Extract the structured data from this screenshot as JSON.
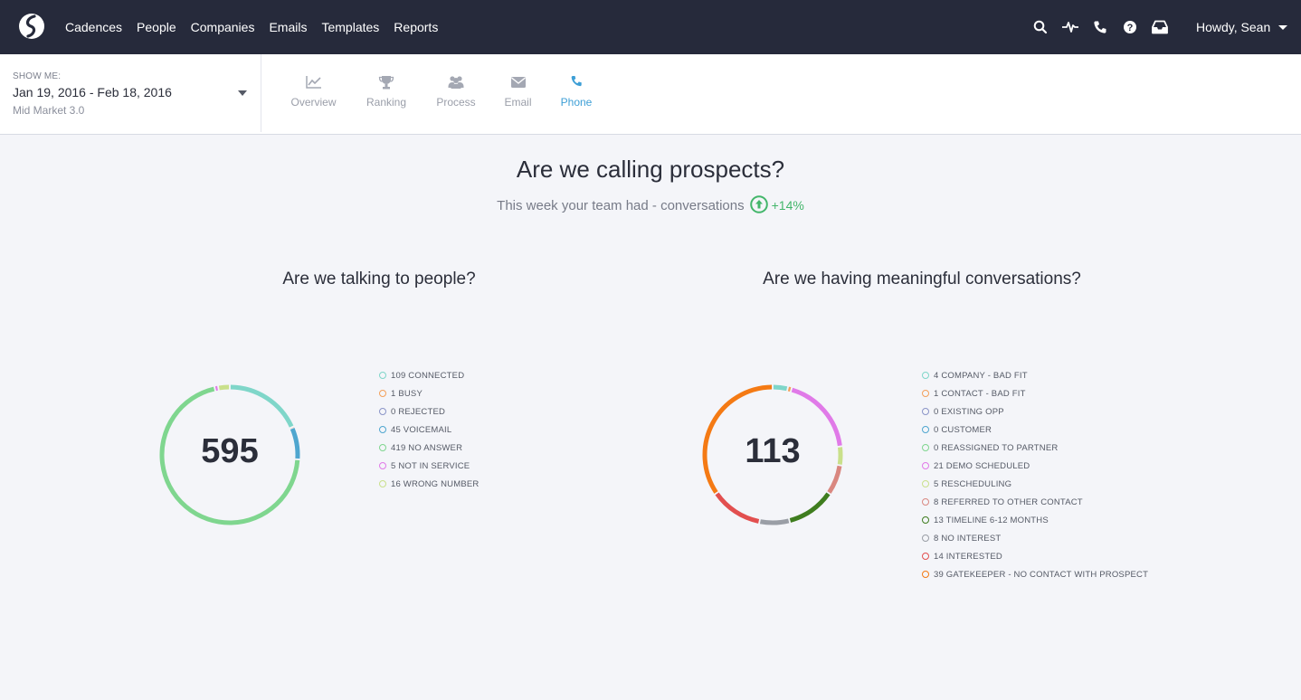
{
  "nav": {
    "links": [
      "Cadences",
      "People",
      "Companies",
      "Emails",
      "Templates",
      "Reports"
    ],
    "user_greeting": "Howdy, Sean",
    "icons": [
      "search-icon",
      "activity-icon",
      "phone-icon",
      "help-icon",
      "inbox-icon"
    ]
  },
  "filter": {
    "label": "SHOW ME:",
    "date_range": "Jan 19, 2016 - Feb 18, 2016",
    "segment": "Mid Market 3.0"
  },
  "tabs": [
    {
      "label": "Overview",
      "icon": "line-chart-icon",
      "active": false
    },
    {
      "label": "Ranking",
      "icon": "trophy-icon",
      "active": false
    },
    {
      "label": "Process",
      "icon": "users-icon",
      "active": false
    },
    {
      "label": "Email",
      "icon": "envelope-icon",
      "active": false
    },
    {
      "label": "Phone",
      "icon": "phone-icon",
      "active": true
    }
  ],
  "heading": {
    "title": "Are we calling prospects?",
    "subtitle": "This week your team had - conversations",
    "change": "+14%"
  },
  "charts": [
    {
      "title": "Are we talking to people?",
      "total": "595",
      "legend": [
        {
          "label": "109 CONNECTED",
          "value": 109,
          "color": "#7fd6c9"
        },
        {
          "label": "1 BUSY",
          "value": 1,
          "color": "#f3a05a"
        },
        {
          "label": "0 REJECTED",
          "value": 0,
          "color": "#8a94c7"
        },
        {
          "label": "45 VOICEMAIL",
          "value": 45,
          "color": "#4fa6cf"
        },
        {
          "label": "419 NO ANSWER",
          "value": 419,
          "color": "#7fd68f"
        },
        {
          "label": "5 NOT IN SERVICE",
          "value": 5,
          "color": "#e07ae8"
        },
        {
          "label": "16 WRONG NUMBER",
          "value": 16,
          "color": "#c9e08b"
        }
      ]
    },
    {
      "title": "Are we having meaningful conversations?",
      "total": "113",
      "legend": [
        {
          "label": "4 COMPANY - BAD FIT",
          "value": 4,
          "color": "#7fd6c9"
        },
        {
          "label": "1 CONTACT - BAD FIT",
          "value": 1,
          "color": "#f3a05a"
        },
        {
          "label": "0 EXISTING OPP",
          "value": 0,
          "color": "#8a94c7"
        },
        {
          "label": "0 CUSTOMER",
          "value": 0,
          "color": "#4fa6cf"
        },
        {
          "label": "0 REASSIGNED TO PARTNER",
          "value": 0,
          "color": "#7fd68f"
        },
        {
          "label": "21 DEMO SCHEDULED",
          "value": 21,
          "color": "#e07ae8"
        },
        {
          "label": "5 RESCHEDULING",
          "value": 5,
          "color": "#c9e08b"
        },
        {
          "label": "8 REFERRED TO OTHER CONTACT",
          "value": 8,
          "color": "#d98780"
        },
        {
          "label": "13 TIMELINE 6-12 MONTHS",
          "value": 13,
          "color": "#3f7d1f"
        },
        {
          "label": "8 NO INTEREST",
          "value": 8,
          "color": "#9a9ea6"
        },
        {
          "label": "14 INTERESTED",
          "value": 14,
          "color": "#e24f4f"
        },
        {
          "label": "39 GATEKEEPER - NO CONTACT WITH PROSPECT",
          "value": 39,
          "color": "#f47a14"
        }
      ]
    }
  ]
}
